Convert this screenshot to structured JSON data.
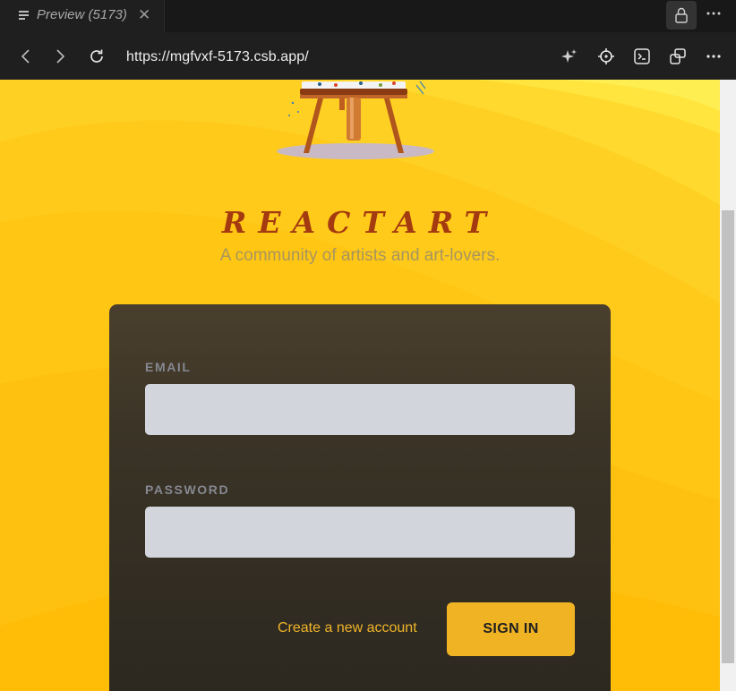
{
  "browser": {
    "tab": {
      "title": "Preview (5173)",
      "icon": "list-icon",
      "close_icon": "close-icon"
    },
    "toolbar_icons": [
      "lock-icon",
      "more-icon"
    ],
    "nav": {
      "back_icon": "chevron-left-icon",
      "forward_icon": "chevron-right-icon",
      "reload_icon": "reload-icon",
      "url": "https://mgfvxf-5173.csb.app/",
      "right_icons": [
        "sparkle-icon",
        "crosshair-icon",
        "terminal-icon",
        "window-icon",
        "more-icon"
      ]
    }
  },
  "page": {
    "brand": "REACTART",
    "tagline": "A community of artists and art-lovers.",
    "form": {
      "email_label": "EMAIL",
      "email_value": "",
      "password_label": "PASSWORD",
      "password_value": "",
      "create_link": "Create a new account",
      "signin_button": "SIGN IN"
    },
    "colors": {
      "background": "#ffc21a",
      "brand": "#a33a10",
      "accent": "#f0b323",
      "card": "#3a3326"
    }
  }
}
